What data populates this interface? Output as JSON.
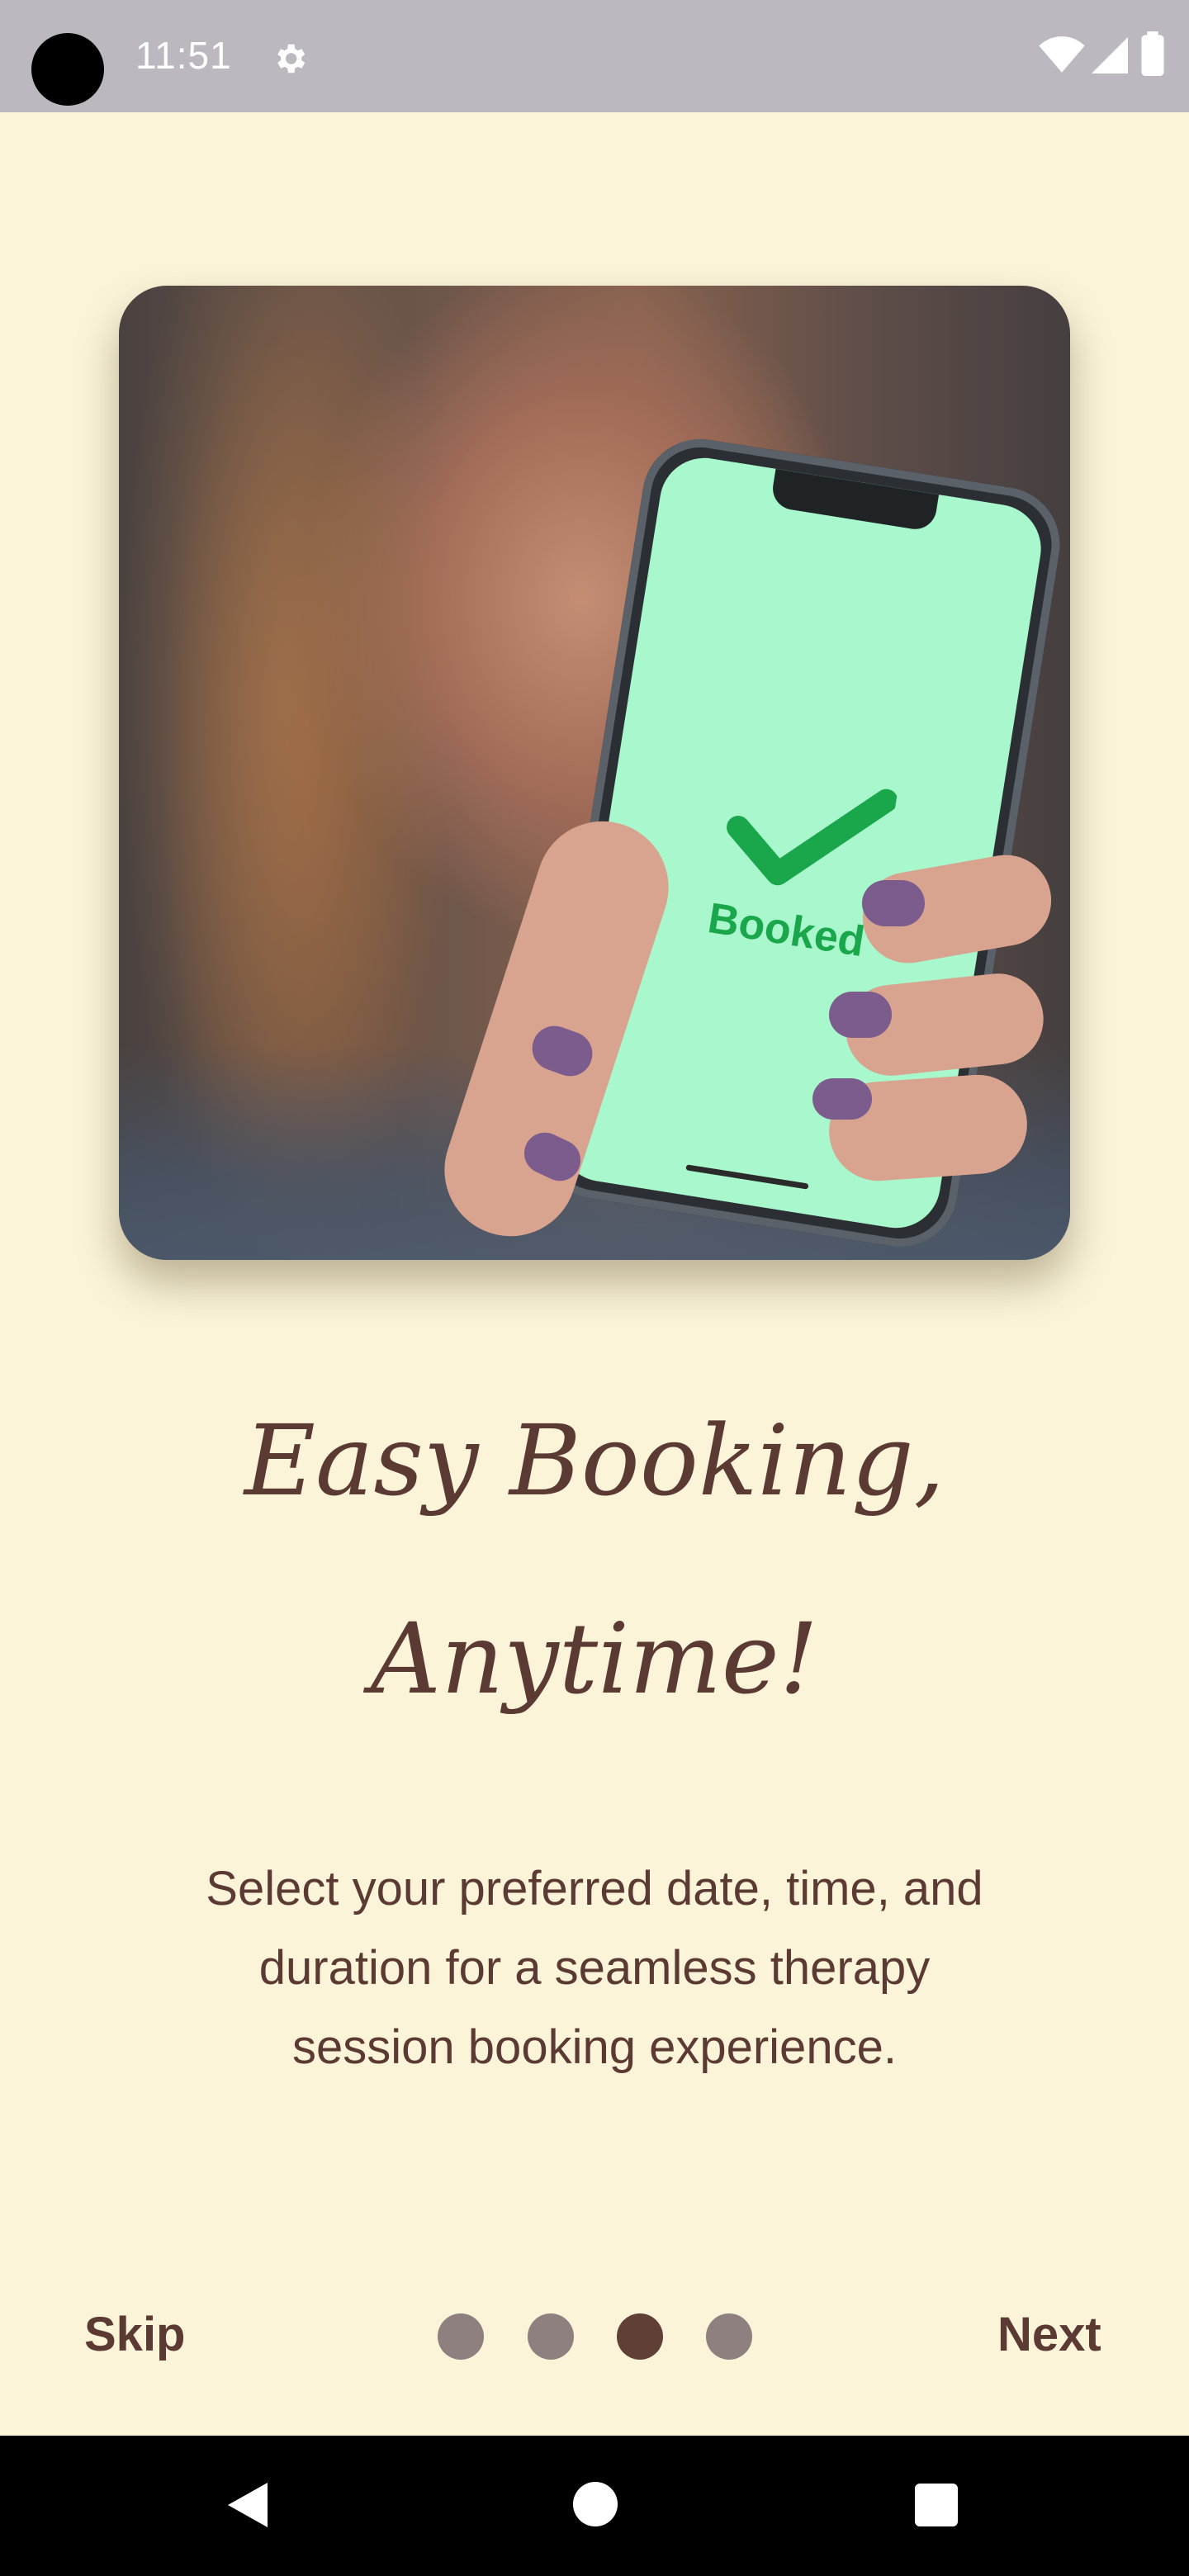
{
  "status_bar": {
    "time": "11:51",
    "icons": [
      "settings-gear-icon",
      "wifi-icon",
      "signal-icon",
      "battery-icon"
    ]
  },
  "hero_image": {
    "screen_text": "Booked",
    "screen_color": "#a8f7cd",
    "check_color": "#1aa64a"
  },
  "onboarding": {
    "title_line1": "Easy Booking,",
    "title_line2": "Anytime!",
    "description_line1": "Select your preferred date, time, and",
    "description_line2": "duration for a seamless therapy",
    "description_line3": "session booking experience.",
    "skip_label": "Skip",
    "next_label": "Next",
    "page_indicator": {
      "total": 4,
      "current": 3
    }
  },
  "colors": {
    "background": "#fbf4d9",
    "text_brown": "#5b3a33",
    "dot_inactive": "#8f8080",
    "dot_active": "#5f3f36"
  },
  "nav_bar": {
    "icons": [
      "back-icon",
      "home-icon",
      "recents-icon"
    ]
  }
}
